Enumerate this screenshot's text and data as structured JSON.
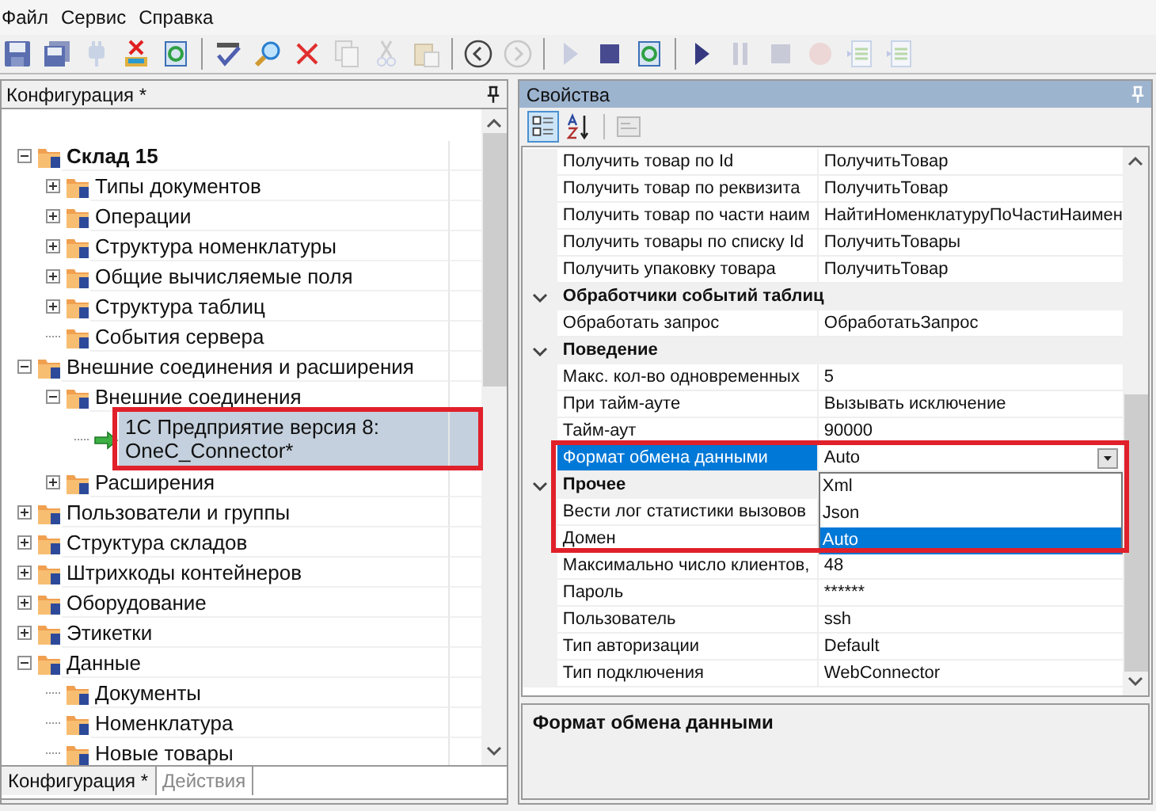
{
  "menu": [
    {
      "label": "Файл"
    },
    {
      "label": "Сервис"
    },
    {
      "label": "Справка"
    }
  ],
  "tree": {
    "title": "Конфигурация *",
    "items": [
      {
        "label": "Склад 15",
        "bold": true,
        "expanded": true,
        "selected": false,
        "children": [
          {
            "label": "Типы документов",
            "bold": false,
            "expanded": false,
            "selected": false
          },
          {
            "label": "Операции",
            "bold": false,
            "expanded": false,
            "selected": false
          },
          {
            "label": "Структура номенклатуры",
            "bold": false,
            "expanded": false,
            "selected": false
          },
          {
            "label": "Общие вычисляемые поля",
            "bold": false,
            "expanded": false,
            "selected": false
          },
          {
            "label": "Структура таблиц",
            "bold": false,
            "expanded": false,
            "selected": false
          },
          {
            "label": "События сервера",
            "bold": false,
            "selected": false
          }
        ]
      },
      {
        "label": "Внешние соединения и расширения",
        "bold": false,
        "expanded": true,
        "selected": false,
        "children": [
          {
            "label": "Внешние соединения",
            "bold": false,
            "expanded": true,
            "selected": false,
            "children": [
              {
                "label": "1С Предприятие версия 8: OneC_Connector*",
                "bold": false,
                "selected": true
              }
            ]
          },
          {
            "label": "Расширения",
            "bold": false,
            "expanded": false,
            "selected": false
          }
        ]
      },
      {
        "label": "Пользователи и группы",
        "bold": false,
        "expanded": false,
        "selected": false
      },
      {
        "label": "Структура складов",
        "bold": false,
        "expanded": false,
        "selected": false
      },
      {
        "label": "Штрихкоды контейнеров",
        "bold": false,
        "expanded": false,
        "selected": false
      },
      {
        "label": "Оборудование",
        "bold": false,
        "expanded": false,
        "selected": false
      },
      {
        "label": "Этикетки",
        "bold": false,
        "expanded": false,
        "selected": false
      },
      {
        "label": "Данные",
        "bold": false,
        "expanded": true,
        "selected": false,
        "children": [
          {
            "label": "Документы",
            "bold": false,
            "selected": false
          },
          {
            "label": "Номенклатура",
            "bold": false,
            "selected": false
          },
          {
            "label": "Новые товары",
            "bold": false,
            "selected": false
          }
        ]
      }
    ]
  },
  "bottom_tabs": [
    {
      "label": "Конфигурация *",
      "selected": true
    },
    {
      "label": "Действия",
      "selected": false
    }
  ],
  "properties": {
    "title": "Свойства",
    "rows": [
      {
        "kind": "property",
        "name": "Получить товар по Id",
        "value": "ПолучитьТовар",
        "selected": false
      },
      {
        "kind": "property",
        "name": "Получить товар по реквизита",
        "value": "ПолучитьТовар",
        "selected": false
      },
      {
        "kind": "property",
        "name": "Получить товар по части наим",
        "value": "НайтиНоменклатуруПоЧастиНаимен",
        "selected": false
      },
      {
        "kind": "property",
        "name": "Получить товары по списку Id",
        "value": "ПолучитьТовары",
        "selected": false
      },
      {
        "kind": "property",
        "name": "Получить упаковку товара",
        "value": "ПолучитьТовар",
        "selected": false
      },
      {
        "kind": "category",
        "name": "Обработчики событий таблиц",
        "expanded": true
      },
      {
        "kind": "property",
        "name": "Обработать запрос",
        "value": "ОбработатьЗапрос",
        "selected": false
      },
      {
        "kind": "category",
        "name": "Поведение",
        "expanded": true
      },
      {
        "kind": "property",
        "name": "Макс. кол-во одновременных",
        "value": "5",
        "selected": false
      },
      {
        "kind": "property",
        "name": "При тайм-ауте",
        "value": "Вызывать исключение",
        "selected": false
      },
      {
        "kind": "property",
        "name": "Тайм-аут",
        "value": "90000",
        "selected": false
      },
      {
        "kind": "property",
        "name": "Формат обмена данными",
        "value": "Auto",
        "selected": true,
        "options": [
          {
            "label": "Xml",
            "selected": false
          },
          {
            "label": "Json",
            "selected": false
          },
          {
            "label": "Auto",
            "selected": true
          }
        ]
      },
      {
        "kind": "category",
        "name": "Прочее",
        "expanded": true
      },
      {
        "kind": "property",
        "name": "Вести лог статистики вызовов",
        "selected": false
      },
      {
        "kind": "property",
        "name": "Домен",
        "selected": false
      },
      {
        "kind": "property",
        "name": "Максимально число клиентов,",
        "value": "48",
        "selected": false
      },
      {
        "kind": "property",
        "name": "Пароль",
        "value": "******",
        "selected": false
      },
      {
        "kind": "property",
        "name": "Пользователь",
        "value": "ssh",
        "selected": false
      },
      {
        "kind": "property",
        "name": "Тип авторизации",
        "value": "Default",
        "selected": false
      },
      {
        "kind": "property",
        "name": "Тип подключения",
        "value": "WebConnector",
        "selected": false
      }
    ]
  },
  "description": {
    "title": "Формат обмена данными"
  }
}
